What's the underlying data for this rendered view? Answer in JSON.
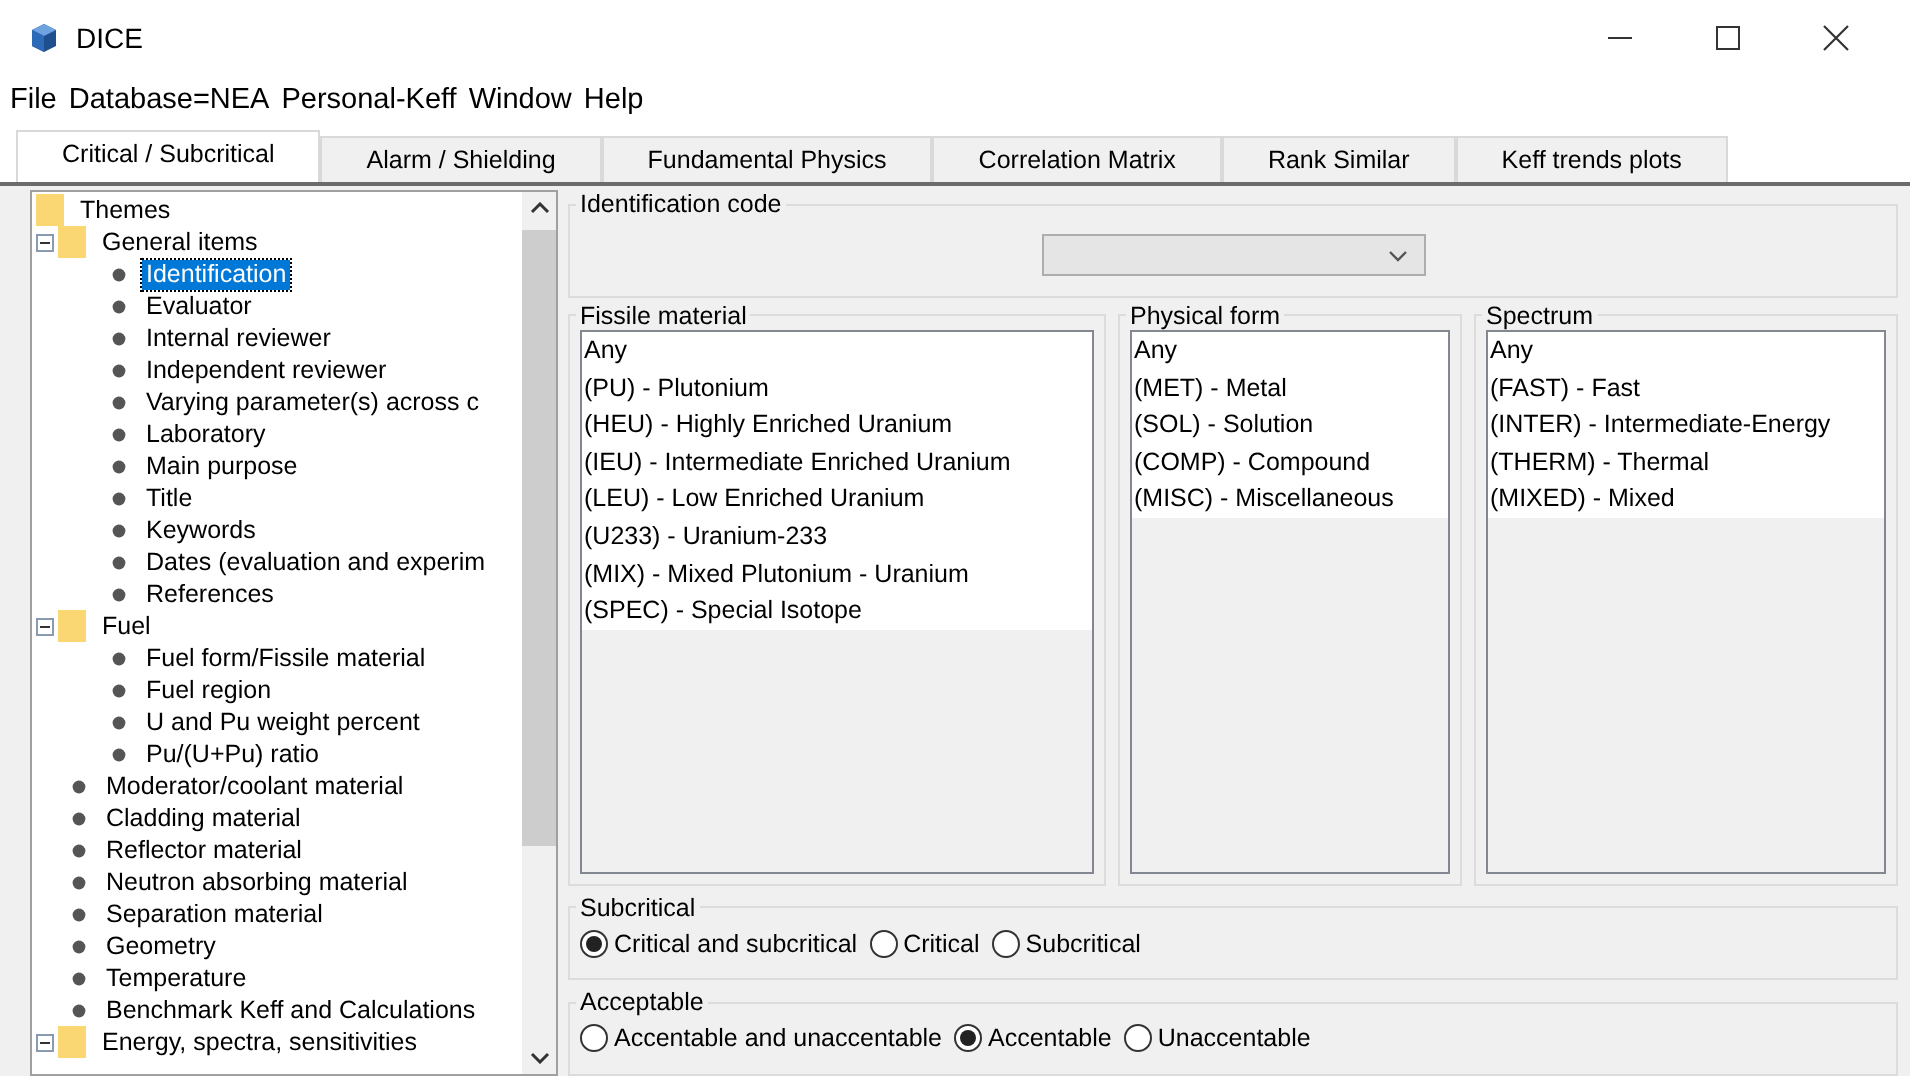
{
  "window": {
    "title": "DICE"
  },
  "menu": [
    "File",
    "Database=NEA",
    "Personal-Keff",
    "Window",
    "Help"
  ],
  "tabs": [
    {
      "label": "Critical / Subcritical",
      "selected": true
    },
    {
      "label": "Alarm / Shielding",
      "selected": false
    },
    {
      "label": "Fundamental Physics",
      "selected": false
    },
    {
      "label": "Correlation Matrix",
      "selected": false
    },
    {
      "label": "Rank Similar",
      "selected": false
    },
    {
      "label": "Keff trends plots",
      "selected": false
    }
  ],
  "tree": {
    "label": "Themes",
    "children": [
      {
        "label": "General items",
        "expanded": true,
        "children": [
          {
            "label": "Identification",
            "selected": true
          },
          {
            "label": "Evaluator",
            "selected": false
          },
          {
            "label": "Internal reviewer",
            "selected": false
          },
          {
            "label": "Independent reviewer",
            "selected": false
          },
          {
            "label": "Varying parameter(s) across c",
            "selected": false
          },
          {
            "label": "Laboratory",
            "selected": false
          },
          {
            "label": "Main purpose",
            "selected": false
          },
          {
            "label": "Title",
            "selected": false
          },
          {
            "label": "Keywords",
            "selected": false
          },
          {
            "label": "Dates (evaluation and experim",
            "selected": false
          },
          {
            "label": "References",
            "selected": false
          }
        ]
      },
      {
        "label": "Fuel",
        "expanded": true,
        "children": [
          {
            "label": "Fuel form/Fissile material",
            "selected": false
          },
          {
            "label": "Fuel region",
            "selected": false
          },
          {
            "label": "U and Pu weight percent",
            "selected": false
          },
          {
            "label": "Pu/(U+Pu) ratio",
            "selected": false
          }
        ]
      },
      {
        "label": "Moderator/coolant material",
        "selected": false
      },
      {
        "label": "Cladding material",
        "selected": false
      },
      {
        "label": "Reflector material",
        "selected": false
      },
      {
        "label": "Neutron absorbing material",
        "selected": false
      },
      {
        "label": "Separation material",
        "selected": false
      },
      {
        "label": "Geometry",
        "selected": false
      },
      {
        "label": "Temperature",
        "selected": false
      },
      {
        "label": "Benchmark Keff and Calculations",
        "selected": false
      },
      {
        "label": "Energy, spectra, sensitivities",
        "expanded": true
      }
    ]
  },
  "identification": {
    "title": "Identification code"
  },
  "lists": [
    {
      "title": "Fissile material",
      "items": [
        "Any",
        "(PU) - Plutonium",
        "(HEU) - Highly Enriched Uranium",
        "(IEU) - Intermediate Enriched Uranium",
        "(LEU) - Low Enriched Uranium",
        "(U233) - Uranium-233",
        "(MIX) - Mixed Plutonium - Uranium",
        "(SPEC) - Special Isotope"
      ]
    },
    {
      "title": "Physical form",
      "items": [
        "Any",
        "(MET) - Metal",
        "(SOL) - Solution",
        "(COMP) - Compound",
        "(MISC) - Miscellaneous"
      ]
    },
    {
      "title": "Spectrum",
      "items": [
        "Any",
        "(FAST) - Fast",
        "(INTER) - Intermediate-Energy",
        "(THERM) - Thermal",
        "(MIXED) - Mixed"
      ]
    }
  ],
  "radio_groups": [
    {
      "title": "Subcritical",
      "options": [
        {
          "label": "Critical and subcritical",
          "selected": true
        },
        {
          "label": "Critical",
          "selected": false
        },
        {
          "label": "Subcritical",
          "selected": false
        }
      ]
    },
    {
      "title": "Acceptable",
      "options": [
        {
          "label": "Accentable and unaccentable",
          "selected": false
        },
        {
          "label": "Accentable",
          "selected": true
        },
        {
          "label": "Unaccentable",
          "selected": false
        }
      ]
    }
  ]
}
